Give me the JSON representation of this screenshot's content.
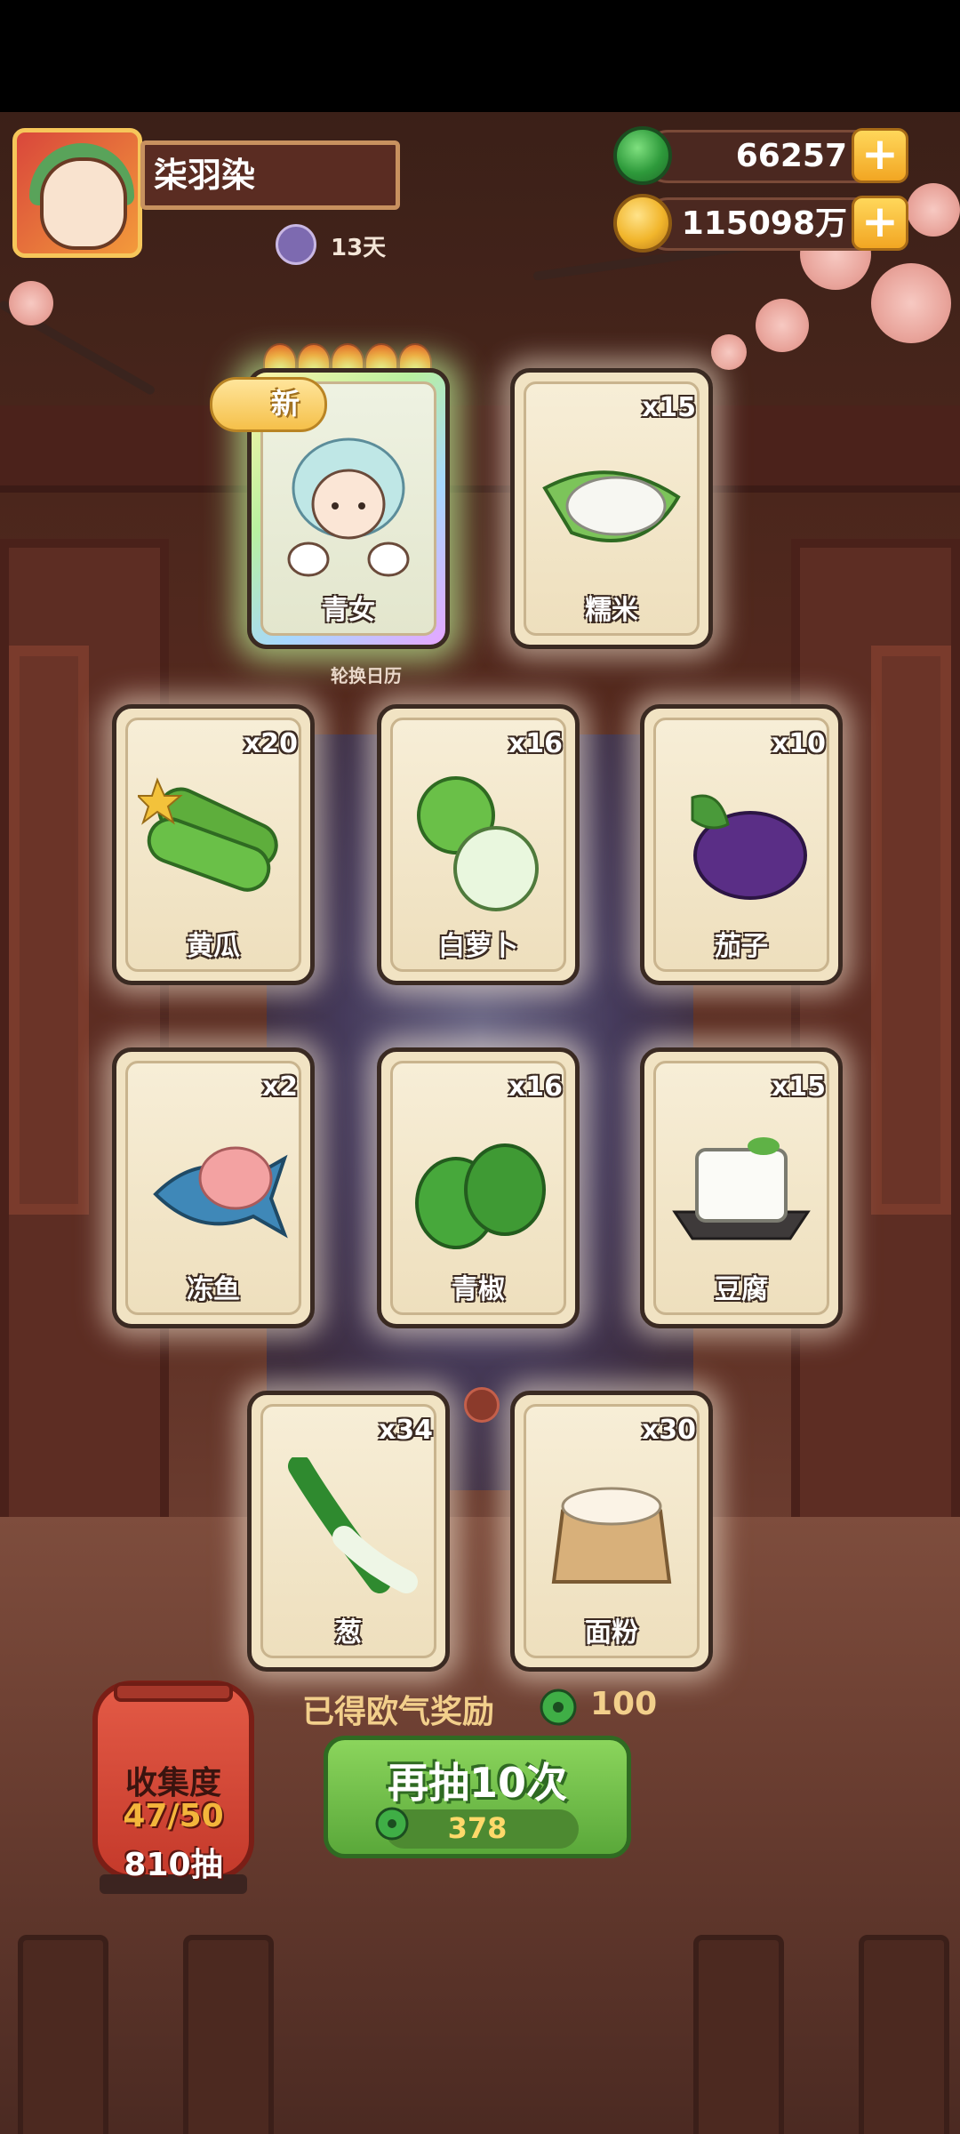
{
  "header": {
    "player_name": "柒羽染",
    "days": "13天",
    "currencies": [
      {
        "icon": "jade-icon",
        "value": "66257"
      },
      {
        "icon": "coin-icon",
        "value": "115098万"
      }
    ]
  },
  "featured_label": "新",
  "rotate_calendar": "轮换日历",
  "cards": [
    {
      "name": "青女",
      "count": "",
      "special": true,
      "stars": 5
    },
    {
      "name": "糯米",
      "count": "x15"
    },
    {
      "name": "黄瓜",
      "count": "x20"
    },
    {
      "name": "白萝卜",
      "count": "x16"
    },
    {
      "name": "茄子",
      "count": "x10"
    },
    {
      "name": "冻鱼",
      "count": "x2"
    },
    {
      "name": "青椒",
      "count": "x16"
    },
    {
      "name": "豆腐",
      "count": "x15"
    },
    {
      "name": "葱",
      "count": "x34"
    },
    {
      "name": "面粉",
      "count": "x30"
    }
  ],
  "collection": {
    "title": "收集度",
    "progress": "47/50",
    "draws": "810抽"
  },
  "reward": {
    "label": "已得欧气奖励",
    "value": "100"
  },
  "draw_button": {
    "label": "再抽10次",
    "cost": "378"
  }
}
